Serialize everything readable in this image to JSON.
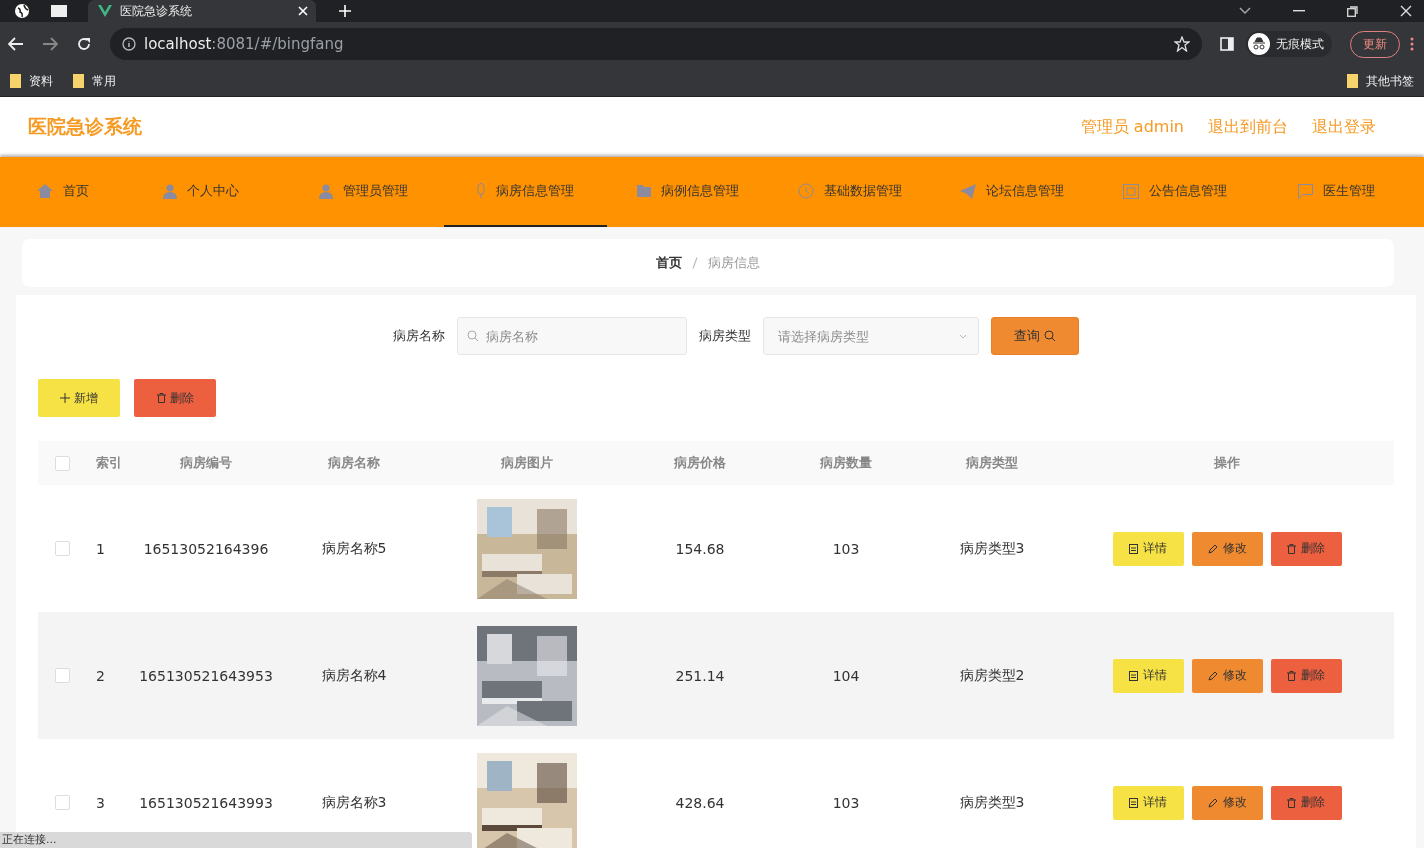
{
  "browser": {
    "tab_title": "医院急诊系统",
    "url_host": "localhost",
    "url_rest": ":8081/#/bingfang",
    "incognito_label": "无痕模式",
    "update_button": "更新",
    "bookmarks": [
      "资料",
      "常用"
    ],
    "other_bookmarks": "其他书签",
    "status_text": "正在连接..."
  },
  "header": {
    "logo": "医院急诊系统",
    "links": [
      "管理员 admin",
      "退出到前台",
      "退出登录"
    ]
  },
  "nav": [
    {
      "label": "首页",
      "selected": false
    },
    {
      "label": "个人中心",
      "selected": false
    },
    {
      "label": "管理员管理",
      "selected": false
    },
    {
      "label": "病房信息管理",
      "selected": true
    },
    {
      "label": "病例信息管理",
      "selected": false
    },
    {
      "label": "基础数据管理",
      "selected": false
    },
    {
      "label": "论坛信息管理",
      "selected": false
    },
    {
      "label": "公告信息管理",
      "selected": false
    },
    {
      "label": "医生管理",
      "selected": false
    }
  ],
  "breadcrumb": [
    "首页",
    "病房信息"
  ],
  "search": {
    "fields": [
      {
        "label": "病房名称",
        "kind": "input",
        "placeholder": "病房名称"
      },
      {
        "label": "病房类型",
        "kind": "select",
        "placeholder": "请选择病房类型"
      }
    ],
    "button": "查询"
  },
  "actions": [
    {
      "label": "新增",
      "kind": "add"
    },
    {
      "label": "删除",
      "kind": "delete"
    }
  ],
  "table": {
    "all_checked": false,
    "columns": [
      "索引",
      "病房编号",
      "病房名称",
      "病房图片",
      "病房价格",
      "病房数量",
      "病房类型",
      "操作"
    ],
    "rows": [
      {
        "index": "1",
        "code": "16513052164396",
        "name": "病房名称5",
        "price": "154.68",
        "count": "103",
        "type": "病房类型3",
        "checked": false,
        "buttons": [
          "详情",
          "修改",
          "删除"
        ]
      },
      {
        "index": "2",
        "code": "165130521643953",
        "name": "病房名称4",
        "price": "251.14",
        "count": "104",
        "type": "病房类型2",
        "checked": false,
        "buttons": [
          "详情",
          "修改",
          "删除"
        ]
      },
      {
        "index": "3",
        "code": "165130521643993",
        "name": "病房名称3",
        "price": "428.64",
        "count": "103",
        "type": "病房类型3",
        "checked": false,
        "buttons": [
          "详情",
          "修改",
          "删除"
        ]
      }
    ]
  }
}
